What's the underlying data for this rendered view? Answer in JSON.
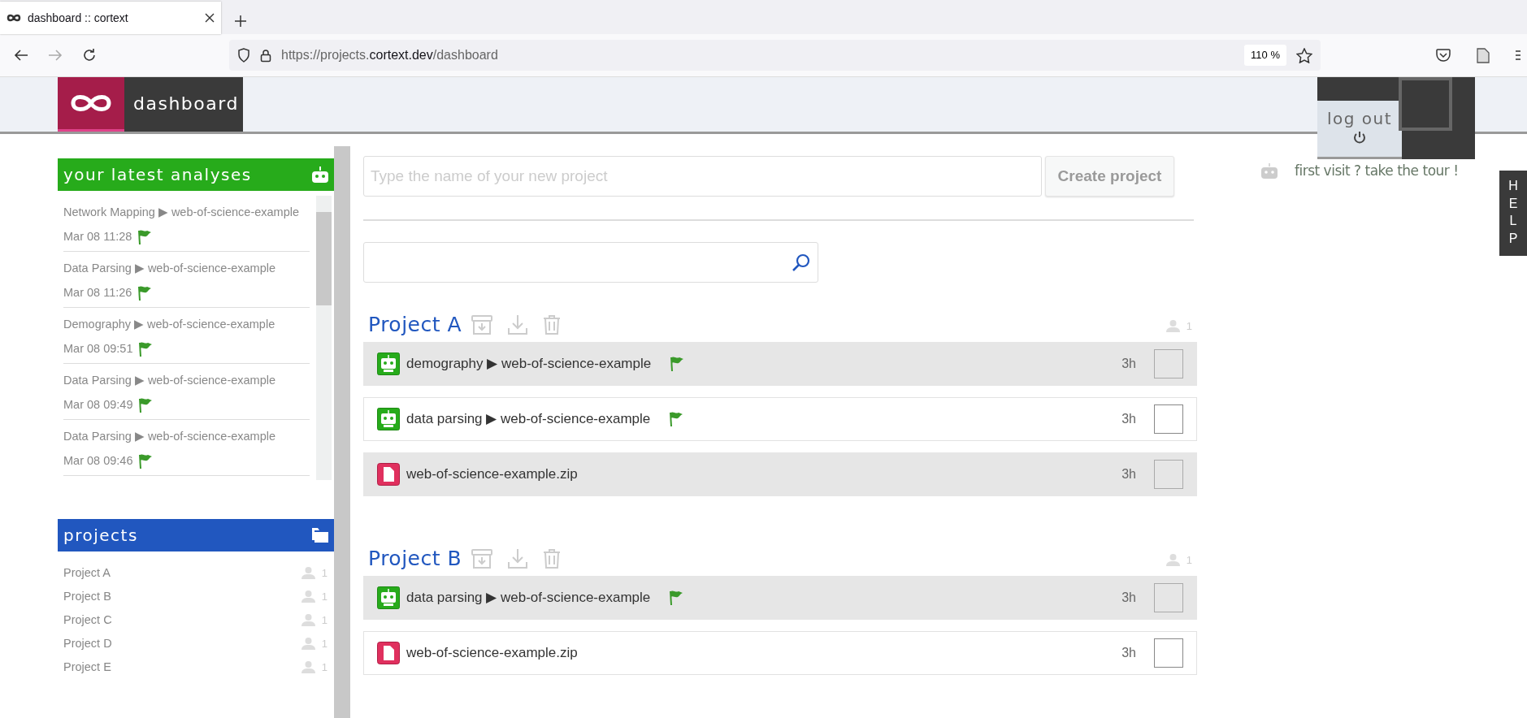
{
  "browser": {
    "tab_title": "dashboard :: cortext",
    "url": {
      "prefix": "https://projects.",
      "domain": "cortext.dev",
      "path": "/dashboard"
    },
    "zoom": "110 %"
  },
  "header": {
    "title": "dashboard"
  },
  "user": {
    "logout_label": "log out"
  },
  "tour": {
    "label": "first visit ? take the tour !"
  },
  "help": {
    "label": "HELP"
  },
  "latest_analyses": {
    "title": "your latest analyses",
    "items": [
      {
        "label": "Network Mapping ▶ web-of-science-example",
        "date": "Mar 08 11:28"
      },
      {
        "label": "Data Parsing ▶ web-of-science-example",
        "date": "Mar 08 11:26"
      },
      {
        "label": "Demography ▶ web-of-science-example",
        "date": "Mar 08 09:51"
      },
      {
        "label": "Data Parsing ▶ web-of-science-example",
        "date": "Mar 08 09:49"
      },
      {
        "label": "Data Parsing ▶ web-of-science-example",
        "date": "Mar 08 09:46"
      }
    ]
  },
  "projects_panel": {
    "title": "projects",
    "items": [
      {
        "name": "Project A",
        "members": "1"
      },
      {
        "name": "Project B",
        "members": "1"
      },
      {
        "name": "Project C",
        "members": "1"
      },
      {
        "name": "Project D",
        "members": "1"
      },
      {
        "name": "Project E",
        "members": "1"
      }
    ]
  },
  "new_project": {
    "placeholder": "Type the name of your new project",
    "button": "Create project"
  },
  "project_groups": [
    {
      "name": "Project A",
      "members": "1",
      "items": [
        {
          "kind": "analysis",
          "label": "demography ▶ web-of-science-example",
          "age": "3h",
          "checked": false
        },
        {
          "kind": "analysis",
          "label": "data parsing ▶ web-of-science-example",
          "age": "3h",
          "checked": false
        },
        {
          "kind": "file",
          "label": "web-of-science-example.zip",
          "age": "3h",
          "checked": false
        }
      ]
    },
    {
      "name": "Project B",
      "members": "1",
      "items": [
        {
          "kind": "analysis",
          "label": "data parsing ▶ web-of-science-example",
          "age": "3h",
          "checked": false
        },
        {
          "kind": "file",
          "label": "web-of-science-example.zip",
          "age": "3h",
          "checked": false
        }
      ]
    }
  ]
}
